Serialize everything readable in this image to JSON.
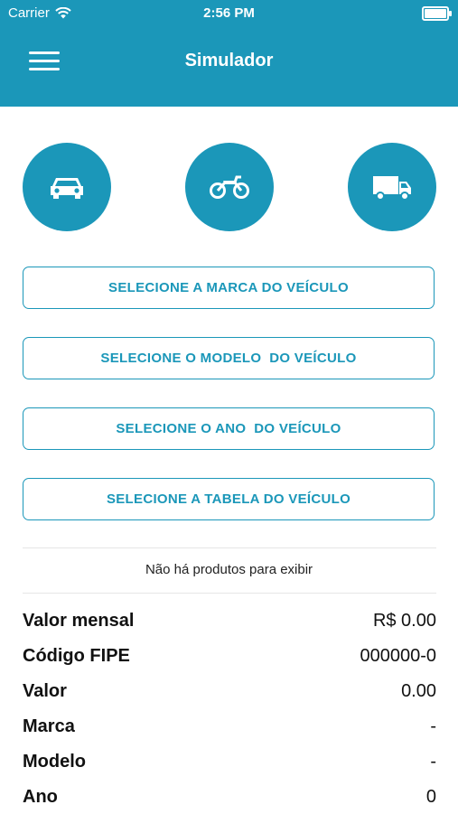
{
  "status_bar": {
    "carrier": "Carrier",
    "time": "2:56 PM"
  },
  "header": {
    "title": "Simulador",
    "color": "#1b97b9"
  },
  "vehicle_types": [
    {
      "icon": "car-icon"
    },
    {
      "icon": "motorcycle-icon"
    },
    {
      "icon": "truck-icon"
    }
  ],
  "selectors": {
    "brand": "SELECIONE A MARCA DO VEÍCULO",
    "model": "SELECIONE O MODELO  DO VEÍCULO",
    "year": "SELECIONE O ANO  DO VEÍCULO",
    "table": "SELECIONE A TABELA DO VEÍCULO"
  },
  "empty_message": "Não há produtos para exibir",
  "details": [
    {
      "label": "Valor mensal",
      "value": "R$ 0.00"
    },
    {
      "label": "Código FIPE",
      "value": "000000-0"
    },
    {
      "label": "Valor",
      "value": "0.00"
    },
    {
      "label": "Marca",
      "value": "-"
    },
    {
      "label": "Modelo",
      "value": "-"
    },
    {
      "label": "Ano",
      "value": "0"
    }
  ]
}
